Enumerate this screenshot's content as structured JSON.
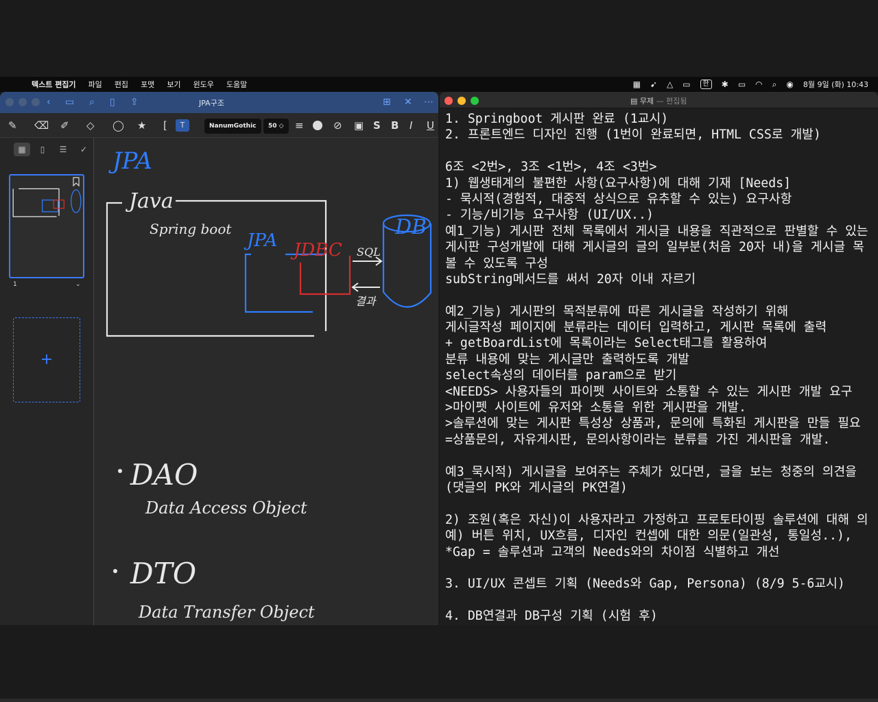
{
  "menubar": {
    "app": "텍스트 편집기",
    "items": [
      "파일",
      "편집",
      "포맷",
      "보기",
      "윈도우",
      "도움말"
    ],
    "ime": "한",
    "clock": "8월 9일 (화)  10:43"
  },
  "goodnotes": {
    "title": "JPA구조",
    "font_chip": "NanumGothic",
    "size_chip": "50",
    "page_number": "1",
    "add_page": "+",
    "canvas_labels": {
      "jpa_heading": "JPA",
      "java": "Java",
      "springboot": "Spring boot",
      "jpa": "JPA",
      "jdbc": "JDBC",
      "db": "DB",
      "sql": "SQL",
      "result": "결과",
      "dao": "DAO",
      "dao_full": "Data Access Object",
      "dto": "DTO",
      "dto_full": "Data Transfer Object"
    }
  },
  "textedit": {
    "title": "무제",
    "status": "— 편집됨",
    "lines": [
      "1. Springboot 게시판 완료 (1교시)",
      "2. 프론트엔드 디자인 진행 (1번이 완료되면, HTML CSS로 개발)",
      "",
      "6조 <2번>, 3조 <1번>, 4조 <3번>",
      "1) 웹생태계의 불편한 사항(요구사항)에 대해 기재 [Needs]",
      "- 묵시적(경험적, 대중적 상식으로 유추할 수 있는) 요구사항",
      "- 기능/비기능 요구사항 (UI/UX..)",
      "예1_기능) 게시판 전체 목록에서 게시글 내용을 직관적으로 판별할 수 있는",
      "게시판 구성개발에 대해 게시글의 글의 일부분(처음 20자 내)을 게시글 목",
      "볼 수 있도록 구성",
      "subString메서드를 써서 20자 이내 자르기",
      "",
      "예2_기능) 게시판의 목적분류에 따른 게시글을 작성하기 위해",
      "게시글작성 페이지에 분류라는 데이터 입력하고, 게시판 목록에 출력",
      "+ getBoardList에 목록이라는 Select태그를 활용하여",
      "분류 내용에 맞는 게시글만 출력하도록 개발",
      "select속성의 데이터를 param으로 받기",
      "<NEEDS> 사용자들의 파이펫 사이트와 소통할 수 있는 게시판 개발 요구",
      ">마이펫 사이트에 유저와 소통을 위한 게시판을 개발.",
      ">솔루션에 맞는 게시판 특성상 상품과, 문의에 특화된 게시판을 만들 필요",
      "=상품문의, 자유게시판, 문의사항이라는 분류를 가진 게시판을 개발.",
      "",
      "예3_묵시적) 게시글을 보여주는 주체가 있다면, 글을 보는 청중의 의견을",
      "(댓글의 PK와 게시글의 PK연결)",
      "",
      "2) 조원(혹은 자신)이 사용자라고 가정하고 프로토타이핑 솔루션에 대해 의",
      "예) 버튼 위치, UX흐름, 디자인 컨셉에 대한 의문(일관성, 통일성..),",
      "*Gap = 솔루션과 고객의 Needs와의 차이점 식별하고 개선",
      "",
      "3. UI/UX 콘셉트 기획 (Needs와 Gap, Persona) (8/9 5-6교시)",
      "",
      "4. DB연결과 DB구성 기획 (시험 후)"
    ]
  },
  "colors": {
    "ink_white": "#e8e8e8",
    "ink_blue": "#2f7dff",
    "ink_red": "#d62e2e",
    "accent": "#3b7bff"
  }
}
